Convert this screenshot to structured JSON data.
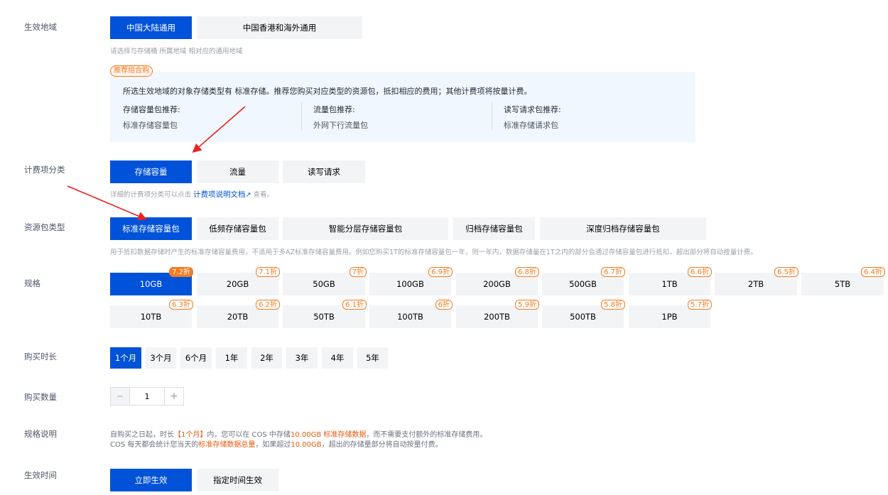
{
  "labels": {
    "region": "生效地域",
    "billing": "计费项分类",
    "package_type": "资源包类型",
    "spec": "规格",
    "duration": "购买时长",
    "quantity": "购买数量",
    "spec_desc": "规格说明",
    "effective": "生效时间"
  },
  "region": {
    "options": [
      "中国大陆通用",
      "中国香港和海外通用"
    ],
    "selected": 0,
    "help": "请选择与存储桶 所属地域 相对应的通用地域"
  },
  "recommend": {
    "tag": "推荐组合购",
    "text": "所选生效地域的对象存储类型有 标准存储。推荐您购买对应类型的资源包，抵扣相应的费用；其他计费项将按量计费。",
    "columns": [
      {
        "title": "存储容量包推荐:",
        "value": "标准存储容量包"
      },
      {
        "title": "流量包推荐:",
        "value": "外网下行流量包"
      },
      {
        "title": "读写请求包推荐:",
        "value": "标准存储请求包"
      }
    ]
  },
  "billing": {
    "options": [
      "存储容量",
      "流量",
      "读写请求"
    ],
    "selected": 0,
    "help_prefix": "详细的计费项分类可以点击",
    "help_link": "计费项说明文档",
    "help_suffix": "查看。"
  },
  "package_type": {
    "options": [
      "标准存储容量包",
      "低频存储容量包",
      "智能分层存储容量包",
      "归档存储容量包",
      "深度归档存储容量包"
    ],
    "selected": 0,
    "help": "用于抵扣数据存储时产生的标准存储容量费用，不适用于多AZ标准存储容量费用。例如您购买1T的标准存储容量包一年，则一年内，数据存储量在1T之内的部分会通过存储容量包进行抵扣，超出部分将自动按量计费。"
  },
  "spec": {
    "row1": [
      {
        "label": "10GB",
        "discount": "7.2折"
      },
      {
        "label": "20GB",
        "discount": "7.1折"
      },
      {
        "label": "50GB",
        "discount": "7折"
      },
      {
        "label": "100GB",
        "discount": "6.9折"
      },
      {
        "label": "200GB",
        "discount": "6.8折"
      },
      {
        "label": "500GB",
        "discount": "6.7折"
      },
      {
        "label": "1TB",
        "discount": "6.6折"
      },
      {
        "label": "2TB",
        "discount": "6.5折"
      },
      {
        "label": "5TB",
        "discount": "6.4折"
      }
    ],
    "row2": [
      {
        "label": "10TB",
        "discount": "6.3折"
      },
      {
        "label": "20TB",
        "discount": "6.2折"
      },
      {
        "label": "50TB",
        "discount": "6.1折"
      },
      {
        "label": "100TB",
        "discount": "6折"
      },
      {
        "label": "200TB",
        "discount": "5.9折"
      },
      {
        "label": "500TB",
        "discount": "5.8折"
      },
      {
        "label": "1PB",
        "discount": "5.7折"
      }
    ],
    "selected": "10GB"
  },
  "duration": {
    "options": [
      "1个月",
      "3个月",
      "6个月",
      "1年",
      "2年",
      "3年",
      "4年",
      "5年"
    ],
    "selected": 0
  },
  "quantity": {
    "minus": "−",
    "value": "1",
    "plus": "+"
  },
  "spec_desc": {
    "l1_a": "自购买之日起，时长",
    "l1_b": "【1个月】",
    "l1_c": "内，您可以在 COS 中存储",
    "l1_d": "10.00GB 标准存储数据",
    "l1_e": "，而不需要支付额外的标准存储费用。",
    "l2_a": "COS 每天都会统计您当天的",
    "l2_b": "标准存储数据总量",
    "l2_c": "，如果超过",
    "l2_d": "10.00GB",
    "l2_e": "，超出的存储量部分将自动按量付费。"
  },
  "effective": {
    "options": [
      "立即生效",
      "指定时间生效"
    ],
    "selected": 0
  },
  "colors": {
    "primary": "#0052d9",
    "accent": "#f47b20",
    "arrow": "#e8231f"
  }
}
